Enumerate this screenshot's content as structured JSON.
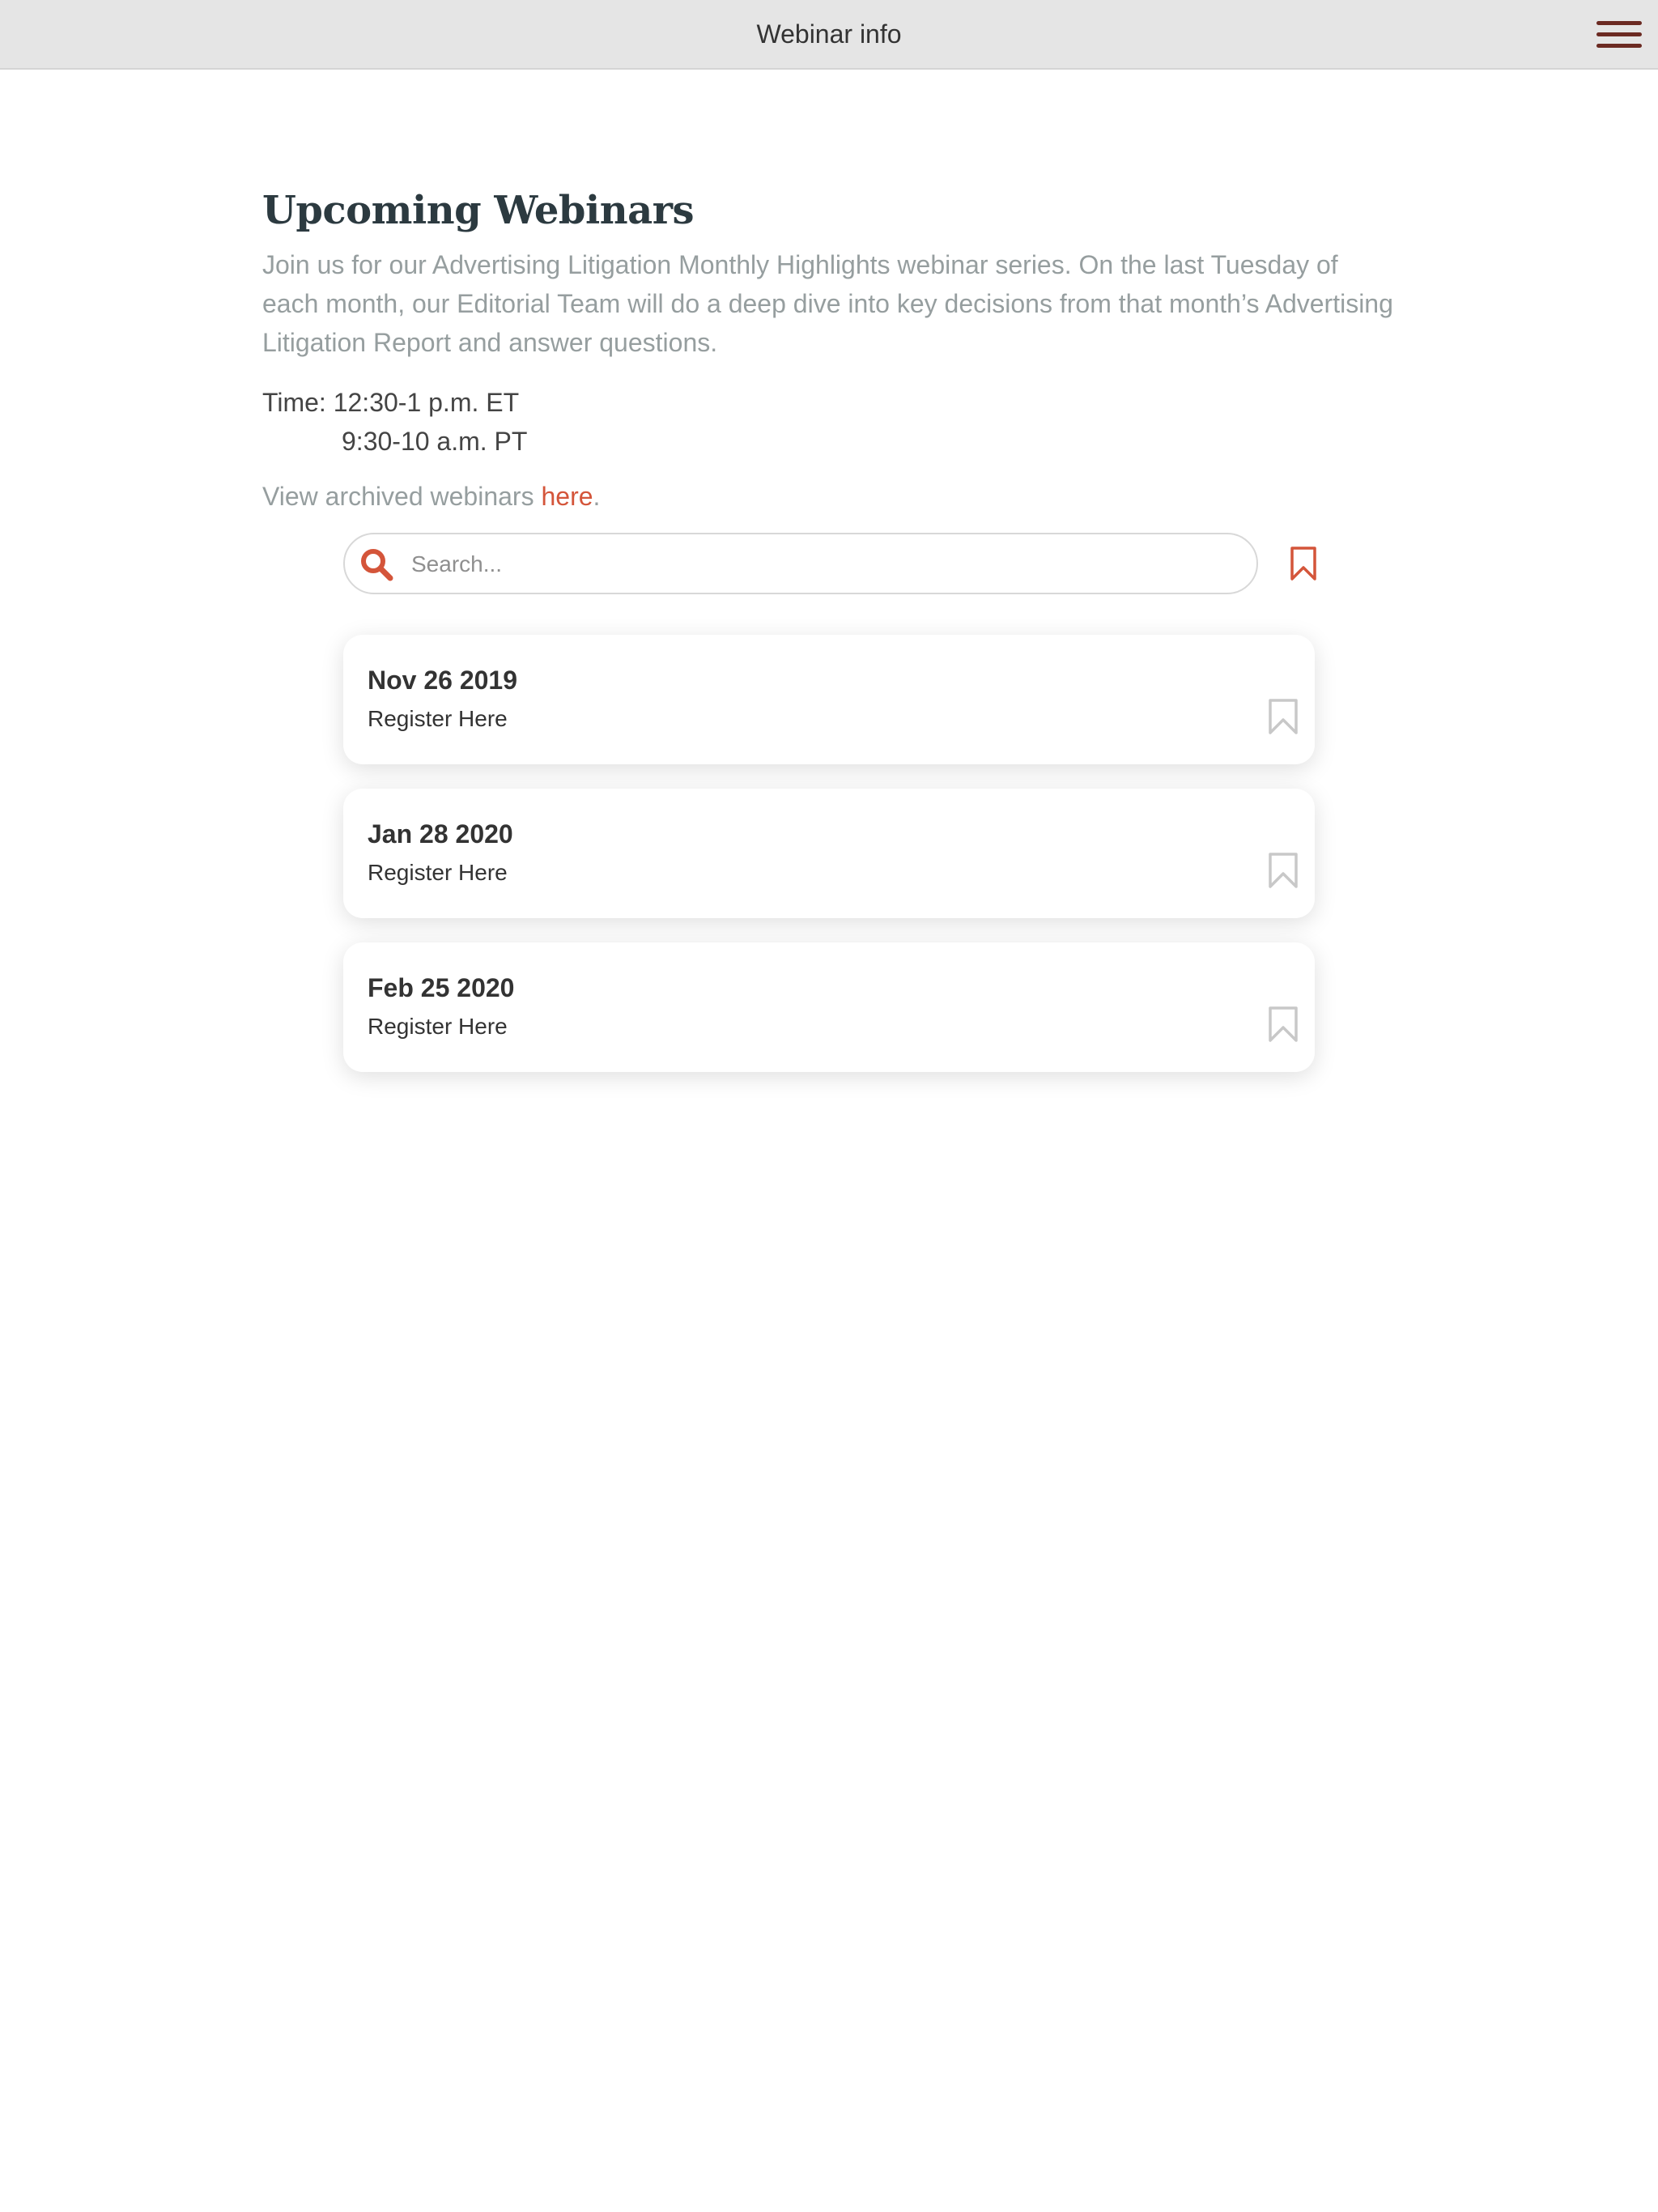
{
  "header": {
    "title": "Webinar info",
    "menu_icon": "hamburger-menu-icon"
  },
  "main": {
    "title": "Upcoming Webinars",
    "intro": "Join us for our Advertising Litigation Monthly Highlights webinar series. On the last Tuesday of each month, our Editorial Team will do a deep dive into key decisions from that month’s Advertising Litigation Report and answer questions.",
    "time_line1": "Time: 12:30-1 p.m. ET",
    "time_line2": "9:30-10 a.m. PT",
    "archive_text": "View archived webinars ",
    "archive_link": "here",
    "archive_suffix": "."
  },
  "search": {
    "placeholder": "Search...",
    "value": "",
    "icon": "search-icon",
    "bookmark_filter_icon": "bookmark-icon"
  },
  "webinars": [
    {
      "date": "Nov 26 2019",
      "link": "Register Here",
      "bookmarked": false
    },
    {
      "date": "Jan 28 2020",
      "link": "Register Here",
      "bookmarked": false
    },
    {
      "date": "Feb 25 2020",
      "link": "Register Here",
      "bookmarked": false
    }
  ],
  "colors": {
    "accent": "#d4553a",
    "header_bg": "#e5e5e5",
    "menu_icon": "#6b2a22",
    "title": "#2c3a40",
    "muted_text": "#969e9f",
    "bookmark_inactive": "#c8c8c8"
  }
}
